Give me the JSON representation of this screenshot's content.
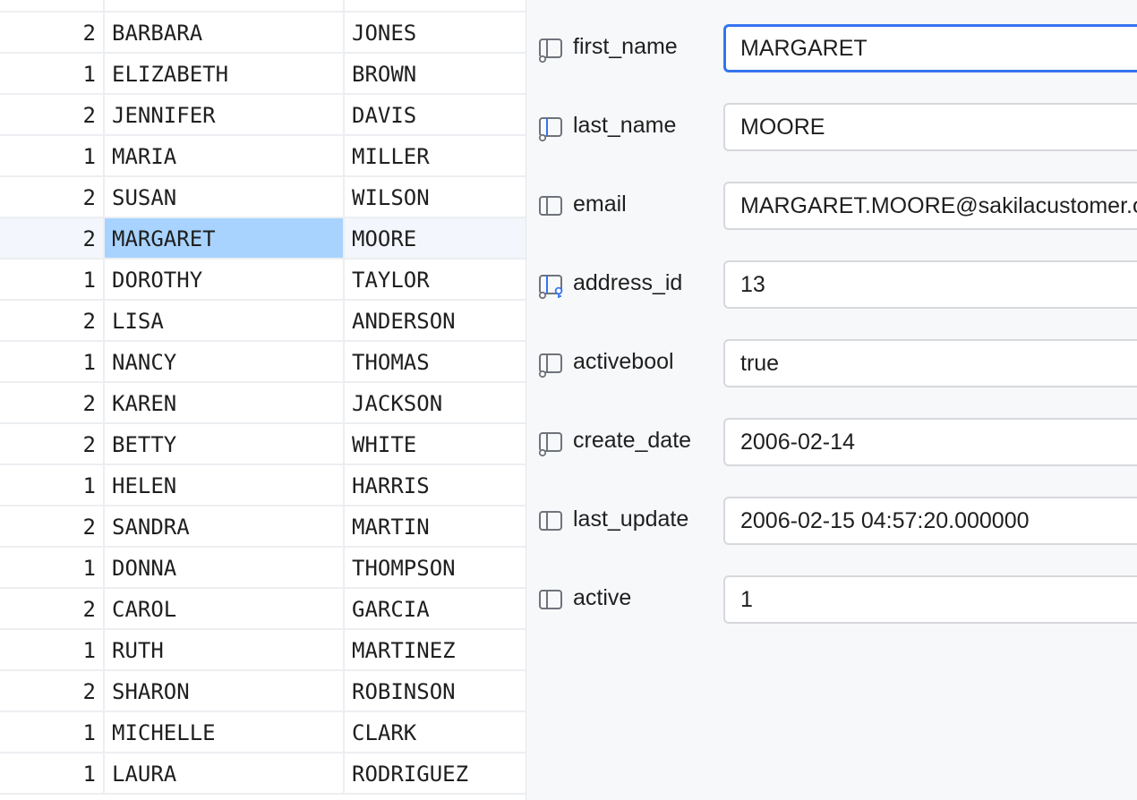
{
  "grid": {
    "rows": [
      {
        "store_id": "2",
        "first_name": "BARBARA",
        "last_name": "JONES"
      },
      {
        "store_id": "1",
        "first_name": "ELIZABETH",
        "last_name": "BROWN"
      },
      {
        "store_id": "2",
        "first_name": "JENNIFER",
        "last_name": "DAVIS"
      },
      {
        "store_id": "1",
        "first_name": "MARIA",
        "last_name": "MILLER"
      },
      {
        "store_id": "2",
        "first_name": "SUSAN",
        "last_name": "WILSON"
      },
      {
        "store_id": "2",
        "first_name": "MARGARET",
        "last_name": "MOORE"
      },
      {
        "store_id": "1",
        "first_name": "DOROTHY",
        "last_name": "TAYLOR"
      },
      {
        "store_id": "2",
        "first_name": "LISA",
        "last_name": "ANDERSON"
      },
      {
        "store_id": "1",
        "first_name": "NANCY",
        "last_name": "THOMAS"
      },
      {
        "store_id": "2",
        "first_name": "KAREN",
        "last_name": "JACKSON"
      },
      {
        "store_id": "2",
        "first_name": "BETTY",
        "last_name": "WHITE"
      },
      {
        "store_id": "1",
        "first_name": "HELEN",
        "last_name": "HARRIS"
      },
      {
        "store_id": "2",
        "first_name": "SANDRA",
        "last_name": "MARTIN"
      },
      {
        "store_id": "1",
        "first_name": "DONNA",
        "last_name": "THOMPSON"
      },
      {
        "store_id": "2",
        "first_name": "CAROL",
        "last_name": "GARCIA"
      },
      {
        "store_id": "1",
        "first_name": "RUTH",
        "last_name": "MARTINEZ"
      },
      {
        "store_id": "2",
        "first_name": "SHARON",
        "last_name": "ROBINSON"
      },
      {
        "store_id": "1",
        "first_name": "MICHELLE",
        "last_name": "CLARK"
      },
      {
        "store_id": "1",
        "first_name": "LAURA",
        "last_name": "RODRIGUEZ"
      }
    ],
    "selected_row": 5
  },
  "record": {
    "fields": [
      {
        "label": "first_name",
        "value": "MARGARET",
        "icon": "column-notnull-icon",
        "focused": true
      },
      {
        "label": "last_name",
        "value": "MOORE",
        "icon": "column-indexed-notnull-icon"
      },
      {
        "label": "email",
        "value": "MARGARET.MOORE@sakilacustomer.org",
        "icon": "column-icon"
      },
      {
        "label": "address_id",
        "value": "13",
        "icon": "column-foreign-key-icon"
      },
      {
        "label": "activebool",
        "value": "true",
        "icon": "column-notnull-icon"
      },
      {
        "label": "create_date",
        "value": "2006-02-14",
        "icon": "column-notnull-icon"
      },
      {
        "label": "last_update",
        "value": "2006-02-15 04:57:20.000000",
        "icon": "column-icon"
      },
      {
        "label": "active",
        "value": "1",
        "icon": "column-icon"
      }
    ]
  },
  "colors": {
    "accent": "#3574f0",
    "selected_cell": "#a8d3ff",
    "selected_row": "#f3f6fc",
    "panel_bg": "#f7f8fa"
  }
}
